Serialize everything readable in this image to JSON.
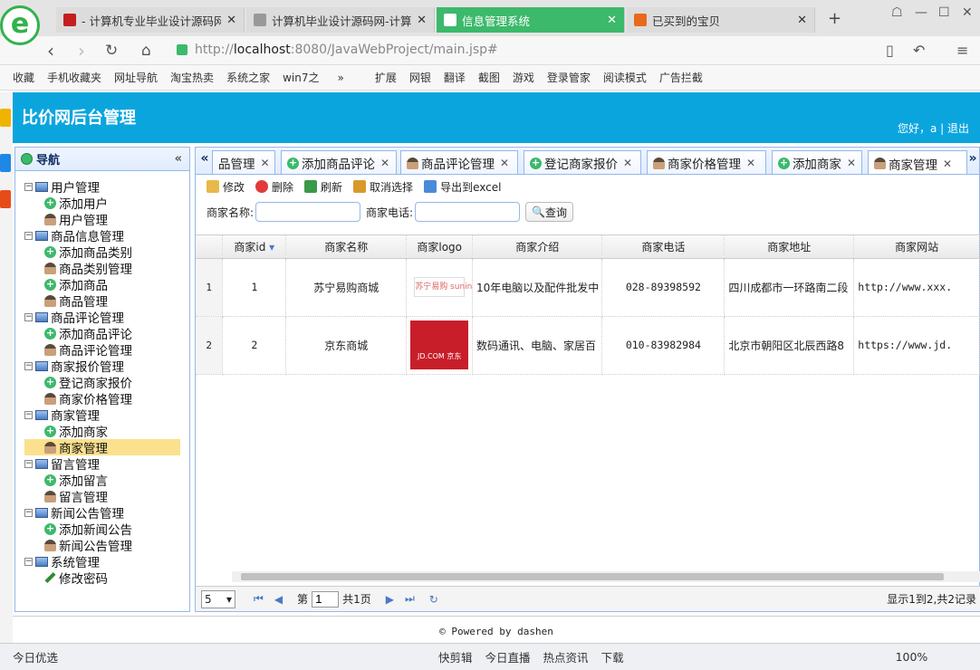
{
  "browser": {
    "tabs": [
      {
        "title": "- 计算机专业毕业设计源码网",
        "color": "#c41e1e"
      },
      {
        "title": "计算机毕业设计源码网-计算机",
        "color": "#999999"
      },
      {
        "title": "信息管理系统",
        "color": "#ffffff"
      },
      {
        "title": "已买到的宝贝",
        "color": "#e86a1a"
      }
    ],
    "url_prefix": "http://",
    "url_host": "localhost",
    "url_rest": ":8080/JavaWebProject/main.jsp#",
    "bookmarks": [
      "收藏",
      "手机收藏夹",
      "网址导航",
      "淘宝热卖",
      "系统之家",
      "win7之",
      "»",
      "扩展",
      "网银",
      "翻译",
      "截图",
      "游戏",
      "登录管家",
      "阅读模式",
      "广告拦截"
    ],
    "status": [
      "今日优选",
      "快剪辑",
      "今日直播",
      "热点资讯",
      "下载",
      "100%"
    ]
  },
  "app": {
    "title": "比价网后台管理",
    "user_text": "您好，a",
    "logout": "退出",
    "footer": "© Powered by dashen"
  },
  "nav": {
    "title": "导航",
    "groups": [
      {
        "label": "用户管理",
        "items": [
          {
            "label": "添加用户",
            "icon": "add"
          },
          {
            "label": "用户管理",
            "icon": "user"
          }
        ]
      },
      {
        "label": "商品信息管理",
        "items": [
          {
            "label": "添加商品类别",
            "icon": "add"
          },
          {
            "label": "商品类别管理",
            "icon": "user"
          },
          {
            "label": "添加商品",
            "icon": "add"
          },
          {
            "label": "商品管理",
            "icon": "user"
          }
        ]
      },
      {
        "label": "商品评论管理",
        "items": [
          {
            "label": "添加商品评论",
            "icon": "add"
          },
          {
            "label": "商品评论管理",
            "icon": "user"
          }
        ]
      },
      {
        "label": "商家报价管理",
        "items": [
          {
            "label": "登记商家报价",
            "icon": "add"
          },
          {
            "label": "商家价格管理",
            "icon": "user"
          }
        ]
      },
      {
        "label": "商家管理",
        "items": [
          {
            "label": "添加商家",
            "icon": "add"
          },
          {
            "label": "商家管理",
            "icon": "user",
            "selected": true
          }
        ]
      },
      {
        "label": "留言管理",
        "items": [
          {
            "label": "添加留言",
            "icon": "add"
          },
          {
            "label": "留言管理",
            "icon": "user"
          }
        ]
      },
      {
        "label": "新闻公告管理",
        "items": [
          {
            "label": "添加新闻公告",
            "icon": "add"
          },
          {
            "label": "新闻公告管理",
            "icon": "user"
          }
        ]
      },
      {
        "label": "系统管理",
        "items": [
          {
            "label": "修改密码",
            "icon": "pen"
          }
        ]
      }
    ]
  },
  "tabs": [
    {
      "label": "品管理",
      "icon": ""
    },
    {
      "label": "添加商品评论",
      "icon": "add"
    },
    {
      "label": "商品评论管理",
      "icon": "user"
    },
    {
      "label": "登记商家报价",
      "icon": "add"
    },
    {
      "label": "商家价格管理",
      "icon": "user"
    },
    {
      "label": "添加商家",
      "icon": "add"
    },
    {
      "label": "商家管理",
      "icon": "user",
      "active": true
    }
  ],
  "toolbar": {
    "edit": "修改",
    "delete": "删除",
    "refresh": "刷新",
    "cancel": "取消选择",
    "export": "导出到excel"
  },
  "search": {
    "name_label": "商家名称:",
    "phone_label": "商家电话:",
    "query": "查询"
  },
  "grid": {
    "columns": [
      "商家id",
      "商家名称",
      "商家logo",
      "商家介绍",
      "商家电话",
      "商家地址",
      "商家网站"
    ],
    "rows": [
      {
        "rn": "1",
        "id": "1",
        "name": "苏宁易购商城",
        "logo": "苏宁易购 suning.com",
        "intro": "10年电脑以及配件批发中",
        "phone": "028-89398592",
        "address": "四川成都市一环路南二段",
        "site": "http://www.xxx."
      },
      {
        "rn": "2",
        "id": "2",
        "name": "京东商城",
        "logo": "JD.COM 京东",
        "intro": "数码通讯、电脑、家居百",
        "phone": "010-83982984",
        "address": "北京市朝阳区北辰西路8",
        "site": "https://www.jd."
      }
    ]
  },
  "pager": {
    "size": "5",
    "page_label": "第",
    "page": "1",
    "total_pages": "共1页",
    "info": "显示1到2,共2记录"
  }
}
